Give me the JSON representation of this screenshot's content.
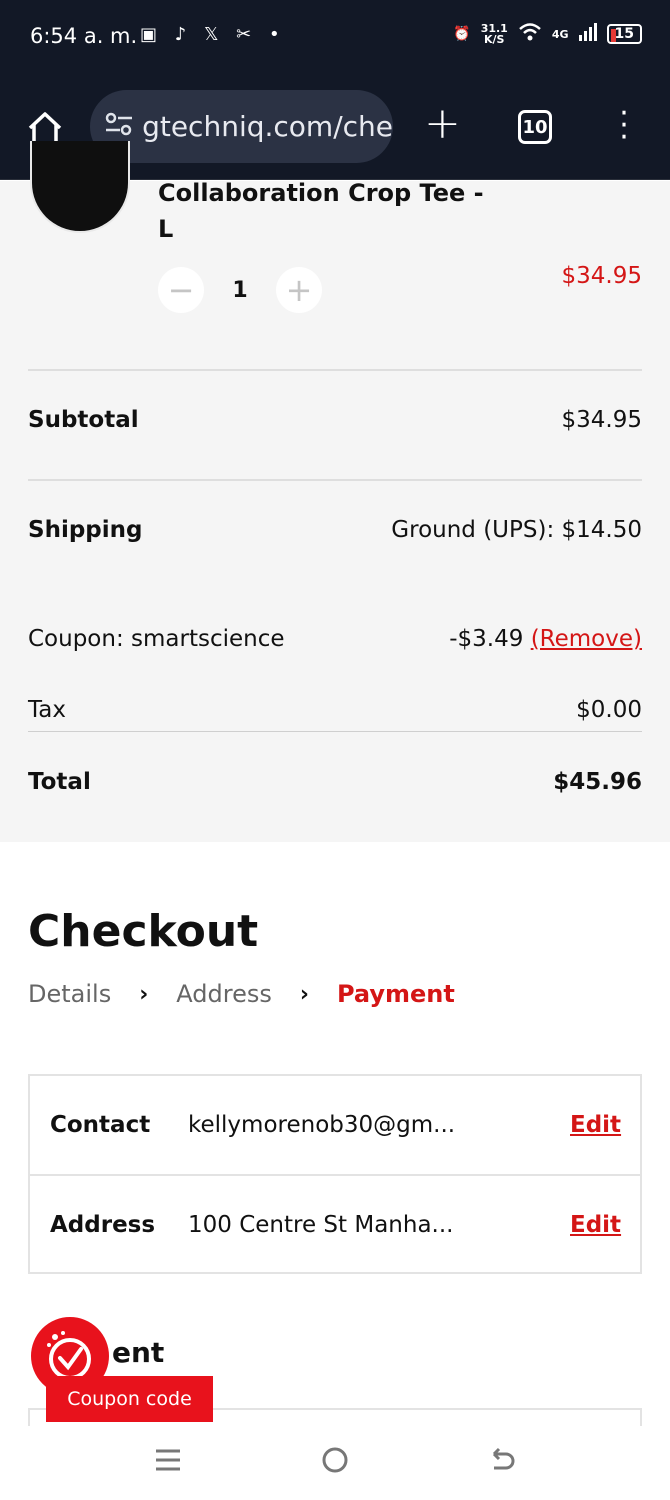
{
  "status_bar": {
    "time": "6:54 a. m.",
    "app_icons": "▣ ♪ 𝕏 ✂ •",
    "speed_value": "31.1",
    "speed_unit": "K/S",
    "network": "4G",
    "battery": "15"
  },
  "browser": {
    "url": "gtechniq.com/che",
    "tab_count": "10"
  },
  "cart_item": {
    "title": "Collaboration Crop Tee - L",
    "quantity": "1",
    "price": "$34.95"
  },
  "summary": {
    "subtotal_label": "Subtotal",
    "subtotal_value": "$34.95",
    "shipping_label": "Shipping",
    "shipping_value": "Ground (UPS): $14.50",
    "coupon_label": "Coupon: smartscience",
    "coupon_value": "-$3.49",
    "coupon_remove": "(Remove)",
    "tax_label": "Tax",
    "tax_value": "$0.00",
    "total_label": "Total",
    "total_value": "$45.96"
  },
  "checkout": {
    "title": "Checkout",
    "steps": [
      "Details",
      "Address",
      "Payment"
    ],
    "contact_label": "Contact",
    "contact_value": "kellymorenob30@gm...",
    "address_label": "Address",
    "address_value": "100 Centre St Manha...",
    "edit_label": "Edit",
    "payment_heading": "ent"
  },
  "coupon_widget": {
    "label": "Coupon code"
  },
  "colors": {
    "accent": "#d41616",
    "topbar": "#121826"
  }
}
